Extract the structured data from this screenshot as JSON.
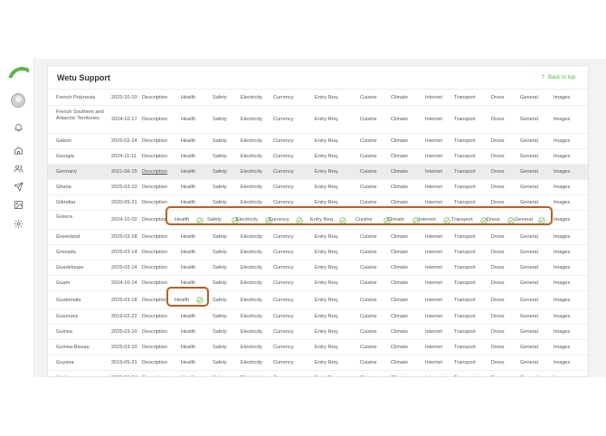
{
  "header": {
    "title": "Wetu Support",
    "back_to_top": "Back to top"
  },
  "sidebar": {
    "icons": [
      "notification-bell-icon",
      "home-icon",
      "users-icon",
      "send-icon",
      "image-icon",
      "gear-icon"
    ]
  },
  "colors": {
    "accent": "#5ab54a",
    "annotation": "#b85f25",
    "highlight_row": "#ececec"
  },
  "rows": [
    {
      "name": "French Polynesia",
      "date": "2023-10-10",
      "description": "Description",
      "health": "Health",
      "safety": "Safety",
      "electricity": "Electricity",
      "currency": "Currency",
      "entry": "Entry Req.",
      "cuisine": "Cuisine",
      "climate": "Climate",
      "internet": "Internet",
      "transport": "Transport",
      "dress": "Dress",
      "general": "General",
      "images": "Images"
    },
    {
      "name": "French Southern and Antarctic Territories",
      "date": "2024-10-17",
      "description": "Description",
      "health": "Health",
      "safety": "Safety",
      "electricity": "Electricity",
      "currency": "Currency",
      "entry": "Entry Req.",
      "cuisine": "Cuisine",
      "climate": "Climate",
      "internet": "Internet",
      "transport": "Transport",
      "dress": "Dress",
      "general": "General",
      "images": "Images"
    },
    {
      "name": "Gabon",
      "date": "2025-02-24",
      "description": "Description",
      "health": "Health",
      "safety": "Safety",
      "electricity": "Electricity",
      "currency": "Currency",
      "entry": "Entry Req.",
      "cuisine": "Cuisine",
      "climate": "Climate",
      "internet": "Internet",
      "transport": "Transport",
      "dress": "Dress",
      "general": "General",
      "images": "Images"
    },
    {
      "name": "Georgia",
      "date": "2024-11-11",
      "description": "Description",
      "health": "Health",
      "safety": "Safety",
      "electricity": "Electricity",
      "currency": "Currency",
      "entry": "Entry Req.",
      "cuisine": "Cuisine",
      "climate": "Climate",
      "internet": "Internet",
      "transport": "Transport",
      "dress": "Dress",
      "general": "General",
      "images": "Images"
    },
    {
      "name": "Germany",
      "date": "2021-06-15",
      "description": "Description",
      "health": "Health",
      "safety": "Safety",
      "electricity": "Electricity",
      "currency": "Currency",
      "entry": "Entry Req.",
      "cuisine": "Cuisine",
      "climate": "Climate",
      "internet": "Internet",
      "transport": "Transport",
      "dress": "Dress",
      "general": "General",
      "images": "Images"
    },
    {
      "name": "Ghana",
      "date": "2025-03-10",
      "description": "Description",
      "health": "Health",
      "safety": "Safety",
      "electricity": "Electricity",
      "currency": "Currency",
      "entry": "Entry Req.",
      "cuisine": "Cuisine",
      "climate": "Climate",
      "internet": "Internet",
      "transport": "Transport",
      "dress": "Dress",
      "general": "General",
      "images": "Images"
    },
    {
      "name": "Gibraltar",
      "date": "2020-09-21",
      "description": "Description",
      "health": "Health",
      "safety": "Safety",
      "electricity": "Electricity",
      "currency": "Currency",
      "entry": "Entry Req.",
      "cuisine": "Cuisine",
      "climate": "Climate",
      "internet": "Internet",
      "transport": "Transport",
      "dress": "Dress",
      "general": "General",
      "images": "Images"
    },
    {
      "name": "Greece",
      "date": "2024-10-02",
      "description": "Description",
      "health": "Health",
      "safety": "Safety",
      "electricity": "Electricity",
      "currency": "Currency",
      "entry": "Entry Req.",
      "cuisine": "Cuisine",
      "climate": "Climate",
      "internet": "Internet",
      "transport": "Transport",
      "dress": "Dress",
      "general": "General",
      "images": "Images"
    },
    {
      "name": "Greenland",
      "date": "2025-03-28",
      "description": "Description",
      "health": "Health",
      "safety": "Safety",
      "electricity": "Electricity",
      "currency": "Currency",
      "entry": "Entry Req.",
      "cuisine": "Cuisine",
      "climate": "Climate",
      "internet": "Internet",
      "transport": "Transport",
      "dress": "Dress",
      "general": "General",
      "images": "Images"
    },
    {
      "name": "Grenada",
      "date": "2025-03-14",
      "description": "Description",
      "health": "Health",
      "safety": "Safety",
      "electricity": "Electricity",
      "currency": "Currency",
      "entry": "Entry Req.",
      "cuisine": "Cuisine",
      "climate": "Climate",
      "internet": "Internet",
      "transport": "Transport",
      "dress": "Dress",
      "general": "General",
      "images": "Images"
    },
    {
      "name": "Guadeloupe",
      "date": "2025-03-14",
      "description": "Description",
      "health": "Health",
      "safety": "Safety",
      "electricity": "Electricity",
      "currency": "Currency",
      "entry": "Entry Req.",
      "cuisine": "Cuisine",
      "climate": "Climate",
      "internet": "Internet",
      "transport": "Transport",
      "dress": "Dress",
      "general": "General",
      "images": "Images"
    },
    {
      "name": "Guam",
      "date": "2024-10-14",
      "description": "Description",
      "health": "Health",
      "safety": "Safety",
      "electricity": "Electricity",
      "currency": "Currency",
      "entry": "Entry Req.",
      "cuisine": "Cuisine",
      "climate": "Climate",
      "internet": "Internet",
      "transport": "Transport",
      "dress": "Dress",
      "general": "General",
      "images": "Images"
    },
    {
      "name": "Guatemala",
      "date": "2025-03-18",
      "description": "Description",
      "health": "Health",
      "safety": "Safety",
      "electricity": "Electricity",
      "currency": "Currency",
      "entry": "Entry Req.",
      "cuisine": "Cuisine",
      "climate": "Climate",
      "internet": "Internet",
      "transport": "Transport",
      "dress": "Dress",
      "general": "General",
      "images": "Images"
    },
    {
      "name": "Guernsey",
      "date": "2019-02-22",
      "description": "Description",
      "health": "Health",
      "safety": "Safety",
      "electricity": "Electricity",
      "currency": "Currency",
      "entry": "Entry Req.",
      "cuisine": "Cuisine",
      "climate": "Climate",
      "internet": "Internet",
      "transport": "Transport",
      "dress": "Dress",
      "general": "General",
      "images": "Images"
    },
    {
      "name": "Guinea",
      "date": "2025-03-10",
      "description": "Description",
      "health": "Health",
      "safety": "Safety",
      "electricity": "Electricity",
      "currency": "Currency",
      "entry": "Entry Req.",
      "cuisine": "Cuisine",
      "climate": "Climate",
      "internet": "Internet",
      "transport": "Transport",
      "dress": "Dress",
      "general": "General",
      "images": "Images"
    },
    {
      "name": "Guinea-Bissau",
      "date": "2025-03-10",
      "description": "Description",
      "health": "Health",
      "safety": "Safety",
      "electricity": "Electricity",
      "currency": "Currency",
      "entry": "Entry Req.",
      "cuisine": "Cuisine",
      "climate": "Climate",
      "internet": "Internet",
      "transport": "Transport",
      "dress": "Dress",
      "general": "General",
      "images": "Images"
    },
    {
      "name": "Guyana",
      "date": "2019-05-21",
      "description": "Description",
      "health": "Health",
      "safety": "Safety",
      "electricity": "Electricity",
      "currency": "Currency",
      "entry": "Entry Req.",
      "cuisine": "Cuisine",
      "climate": "Climate",
      "internet": "Internet",
      "transport": "Transport",
      "dress": "Dress",
      "general": "General",
      "images": "Images"
    },
    {
      "name": "Haiti",
      "date": "2025-03-14",
      "description": "Description",
      "health": "Health",
      "safety": "Safety",
      "electricity": "Electricity",
      "currency": "Currency",
      "entry": "Entry Req.",
      "cuisine": "Cuisine",
      "climate": "Climate",
      "internet": "Internet",
      "transport": "Transport",
      "dress": "Dress",
      "general": "General",
      "images": "Images"
    }
  ],
  "highlighted_row_index": 4,
  "underlined_description_row_index": 4,
  "checked_rows": {
    "7": [
      "health",
      "safety",
      "electricity",
      "currency",
      "entry",
      "cuisine",
      "climate",
      "internet",
      "transport",
      "dress",
      "general"
    ],
    "12": [
      "health"
    ]
  }
}
